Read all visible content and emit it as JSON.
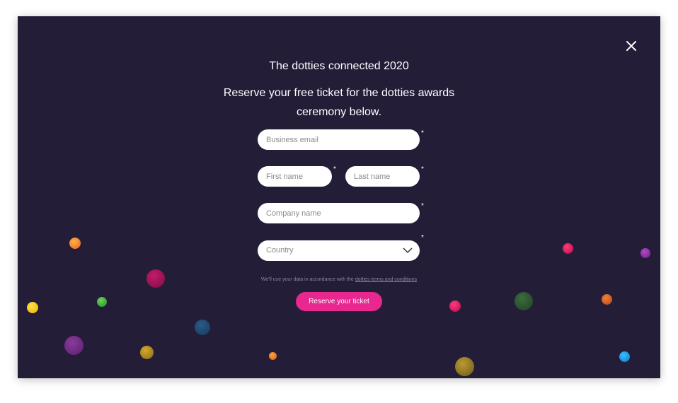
{
  "modal": {
    "title": "The dotties connected 2020",
    "subtitle": "Reserve your free ticket for the dotties awards ceremony below.",
    "required_mark": "*"
  },
  "form": {
    "business_email_placeholder": "Business email",
    "first_name_placeholder": "First name",
    "last_name_placeholder": "Last name",
    "company_name_placeholder": "Company name",
    "country_value": "Country",
    "privacy_note": "We'll use your data in accordance with the",
    "terms_link": "dotties terms and conditions",
    "submit_label": "Reserve your ticket"
  },
  "icons": {
    "close": "close-icon",
    "dropdown": "chevron-down-icon"
  },
  "colors": {
    "background": "#231d38",
    "accent": "#e8278f",
    "field": "#ffffff"
  }
}
